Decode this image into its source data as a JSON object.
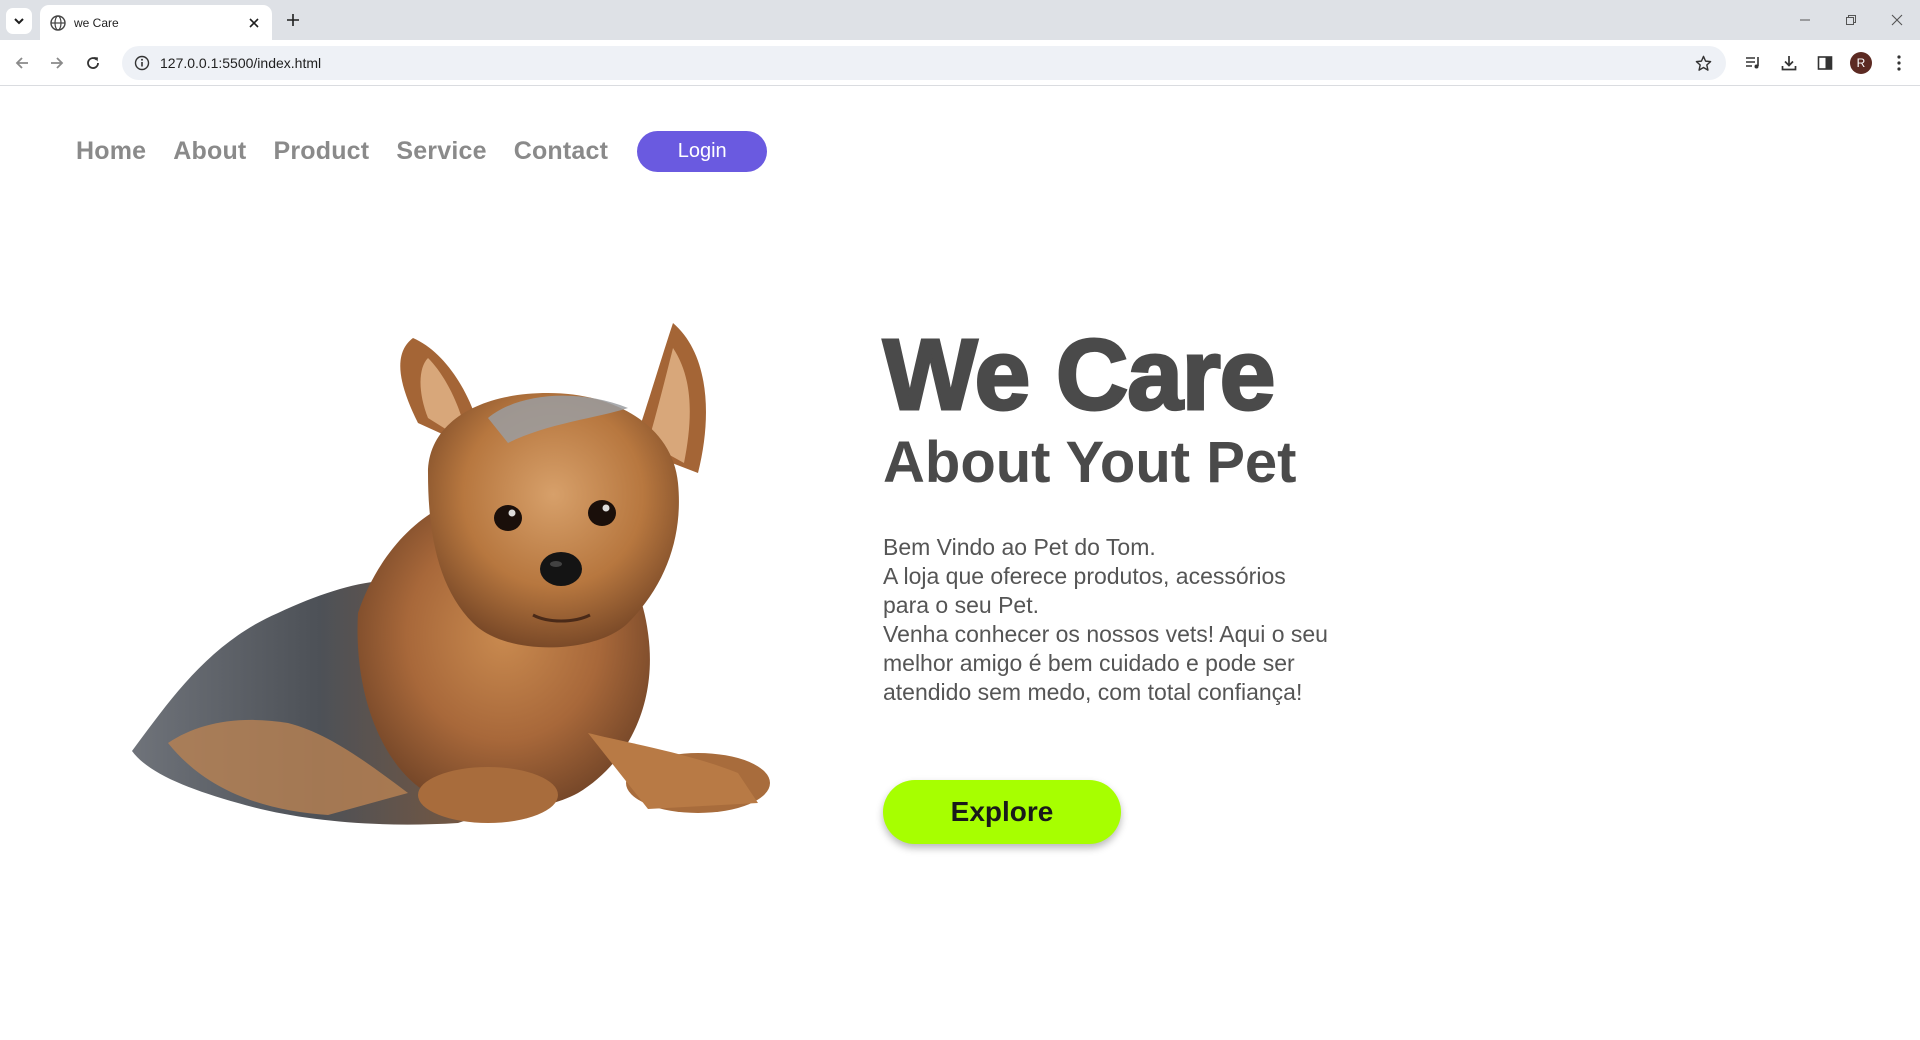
{
  "browser": {
    "tab_title": "we Care",
    "url": "127.0.0.1:5500/index.html",
    "profile_initial": "R"
  },
  "nav": {
    "items": [
      "Home",
      "About",
      "Product",
      "Service",
      "Contact"
    ],
    "login_label": "Login"
  },
  "hero": {
    "title": "We Care",
    "subtitle": "About Yout Pet",
    "lines": [
      "Bem Vindo ao Pet do Tom.",
      "A loja que oferece produtos, acessórios",
      "para o seu Pet.",
      "Venha conhecer os nossos vets! Aqui o seu",
      "melhor amigo é bem cuidado e pode ser",
      "atendido sem medo, com total confiança!"
    ],
    "explore_label": "Explore"
  },
  "colors": {
    "accent_purple": "#6a5ae0",
    "explore_green": "#a7ff00",
    "text_dark": "#4a4a4a",
    "nav_gray": "#8a8a8a"
  },
  "icons": {
    "tab_search": "chevron-down-icon",
    "tab_favicon": "globe-icon",
    "tab_close": "close-icon",
    "new_tab": "plus-icon",
    "back": "arrow-left-icon",
    "forward": "arrow-right-icon",
    "reload": "reload-icon",
    "site_info": "info-icon",
    "bookmark": "star-icon",
    "media": "media-controls-icon",
    "downloads": "download-icon",
    "side_panel": "side-panel-icon",
    "menu": "kebab-menu-icon"
  }
}
